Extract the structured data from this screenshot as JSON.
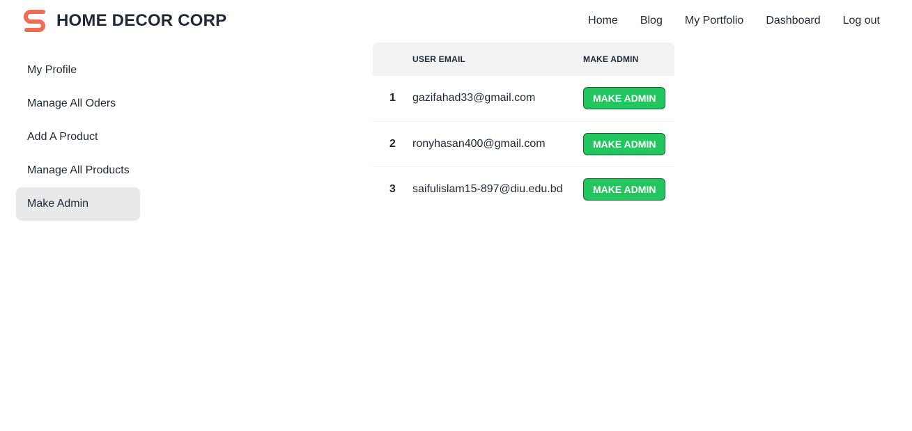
{
  "brand": {
    "name": "HOME DECOR CORP",
    "logo_icon": "s-logo-icon",
    "logo_color": "#ef6c57"
  },
  "nav": {
    "links": [
      "Home",
      "Blog",
      "My Portfolio",
      "Dashboard",
      "Log out"
    ]
  },
  "sidebar": {
    "items": [
      "My Profile",
      "Manage All Oders",
      "Add A Product",
      "Manage All Products",
      "Make Admin"
    ],
    "active": "Make Admin"
  },
  "table": {
    "headers": [
      "",
      "USER EMAIL",
      "MAKE ADMIN"
    ],
    "rows": [
      {
        "num": "1",
        "email": "gazifahad33@gmail.com",
        "button": "MAKE ADMIN"
      },
      {
        "num": "2",
        "email": "ronyhasan400@gmail.com",
        "button": "MAKE ADMIN"
      },
      {
        "num": "3",
        "email": "saifulislam15-897@diu.edu.bd",
        "button": "MAKE ADMIN"
      }
    ]
  },
  "colors": {
    "button_bg": "#22c55e",
    "active_bg": "#e8e9eb",
    "header_bg": "#f2f2f2"
  }
}
